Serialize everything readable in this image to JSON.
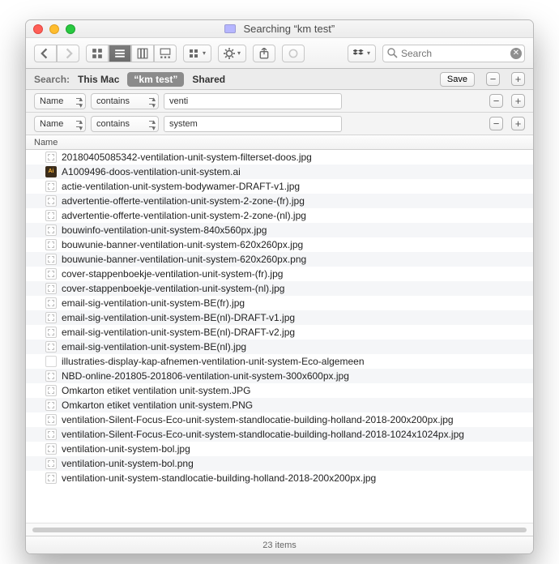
{
  "window": {
    "title": "Searching “km test”"
  },
  "search": {
    "placeholder": "Search"
  },
  "scope": {
    "label": "Search:",
    "this_mac": "This Mac",
    "folder": "“km test”",
    "shared": "Shared",
    "save": "Save"
  },
  "filters": [
    {
      "attr": "Name",
      "op": "contains",
      "value": "venti"
    },
    {
      "attr": "Name",
      "op": "contains",
      "value": "system"
    }
  ],
  "columns": {
    "name": "Name"
  },
  "files": [
    {
      "name": "20180405085342-ventilation-unit-system-filterset-doos.jpg",
      "icon": "jpeg"
    },
    {
      "name": "A1009496-doos-ventilation-unit-system.ai",
      "icon": "ai"
    },
    {
      "name": "actie-ventilation-unit-system-bodywamer-DRAFT-v1.jpg",
      "icon": "jpeg"
    },
    {
      "name": "advertentie-offerte-ventilation-unit-system-2-zone-(fr).jpg",
      "icon": "jpeg"
    },
    {
      "name": "advertentie-offerte-ventilation-unit-system-2-zone-(nl).jpg",
      "icon": "jpeg"
    },
    {
      "name": "bouwinfo-ventilation-unit-system-840x560px.jpg",
      "icon": "jpeg"
    },
    {
      "name": "bouwunie-banner-ventilation-unit-system-620x260px.jpg",
      "icon": "jpeg"
    },
    {
      "name": "bouwunie-banner-ventilation-unit-system-620x260px.png",
      "icon": "jpeg"
    },
    {
      "name": "cover-stappenboekje-ventilation-unit-system-(fr).jpg",
      "icon": "jpeg"
    },
    {
      "name": "cover-stappenboekje-ventilation-unit-system-(nl).jpg",
      "icon": "jpeg"
    },
    {
      "name": "email-sig-ventilation-unit-system-BE(fr).jpg",
      "icon": "jpeg"
    },
    {
      "name": "email-sig-ventilation-unit-system-BE(nl)-DRAFT-v1.jpg",
      "icon": "jpeg"
    },
    {
      "name": "email-sig-ventilation-unit-system-BE(nl)-DRAFT-v2.jpg",
      "icon": "jpeg"
    },
    {
      "name": "email-sig-ventilation-unit-system-BE(nl).jpg",
      "icon": "jpeg"
    },
    {
      "name": "illustraties-display-kap-afnemen-ventilation-unit-system-Eco-algemeen",
      "icon": "blank"
    },
    {
      "name": "NBD-online-201805-201806-ventilation-unit-system-300x600px.jpg",
      "icon": "jpeg"
    },
    {
      "name": "Omkarton etiket ventilation unit-system.JPG",
      "icon": "jpeg"
    },
    {
      "name": "Omkarton etiket ventilation unit-system.PNG",
      "icon": "jpeg"
    },
    {
      "name": "ventilation-Silent-Focus-Eco-unit-system-standlocatie-building-holland-2018-200x200px.jpg",
      "icon": "jpeg"
    },
    {
      "name": "ventilation-Silent-Focus-Eco-unit-system-standlocatie-building-holland-2018-1024x1024px.jpg",
      "icon": "jpeg"
    },
    {
      "name": "ventilation-unit-system-bol.jpg",
      "icon": "jpeg"
    },
    {
      "name": "ventilation-unit-system-bol.png",
      "icon": "jpeg"
    },
    {
      "name": "ventilation-unit-system-standlocatie-building-holland-2018-200x200px.jpg",
      "icon": "jpeg"
    }
  ],
  "status": {
    "count": "23 items"
  }
}
